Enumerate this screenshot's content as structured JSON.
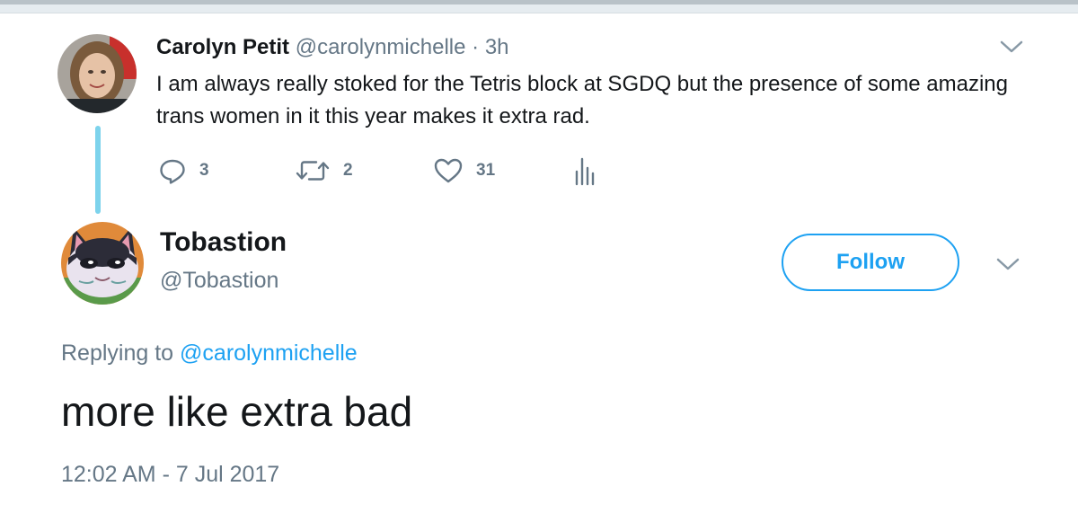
{
  "colors": {
    "accent": "#1da1f2",
    "muted_text": "#657786",
    "text": "#14171a",
    "thread_line": "#7dd3ec"
  },
  "parent_tweet": {
    "display_name": "Carolyn Petit",
    "handle": "@carolynmichelle",
    "separator": "·",
    "time": "3h",
    "text": "I am always really stoked for the Tetris block at SGDQ but the presence of some amazing trans women in it this year makes it extra rad.",
    "actions": {
      "reply_count": "3",
      "retweet_count": "2",
      "like_count": "31"
    },
    "icons": [
      "avatar-photo",
      "chevron-down-icon",
      "reply-icon",
      "retweet-icon",
      "like-icon",
      "analytics-icon"
    ]
  },
  "reply_tweet": {
    "display_name": "Tobastion",
    "handle": "@Tobastion",
    "follow_label": "Follow",
    "replying_prefix": "Replying to",
    "replying_to": "@carolynmichelle",
    "text": "more like extra bad",
    "timestamp": "12:02 AM - 7 Jul 2017",
    "icons": [
      "cat-avatar",
      "chevron-down-icon"
    ]
  }
}
